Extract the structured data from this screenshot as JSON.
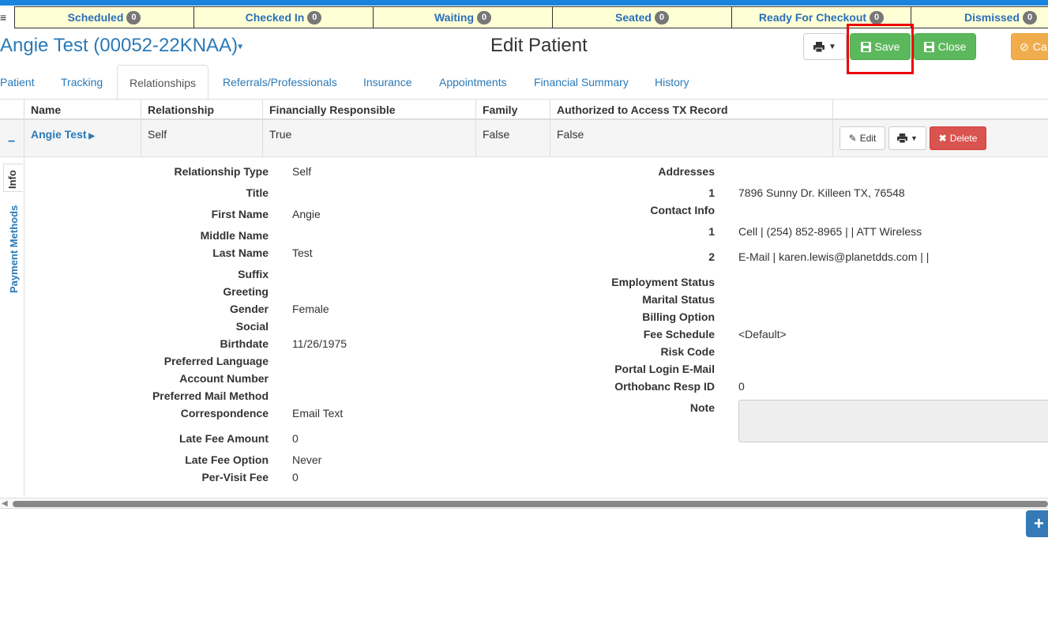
{
  "status_bar": [
    {
      "label": "Scheduled",
      "count": "0"
    },
    {
      "label": "Checked In",
      "count": "0"
    },
    {
      "label": "Waiting",
      "count": "0"
    },
    {
      "label": "Seated",
      "count": "0"
    },
    {
      "label": "Ready For Checkout",
      "count": "0"
    },
    {
      "label": "Dismissed",
      "count": "0"
    }
  ],
  "header": {
    "patient_name": "Angie Test (00052-22KNAA)",
    "page_title": "Edit Patient",
    "save_label": "Save",
    "close_label": "Close",
    "cancel_label": "Ca"
  },
  "tabs": [
    "Patient",
    "Tracking",
    "Relationships",
    "Referrals/Professionals",
    "Insurance",
    "Appointments",
    "Financial Summary",
    "History"
  ],
  "table": {
    "headers": [
      "Name",
      "Relationship",
      "Financially Responsible",
      "Family",
      "Authorized to Access TX Record"
    ],
    "row": {
      "name": "Angie Test",
      "relationship": "Self",
      "financially_responsible": "True",
      "family": "False",
      "authorized": "False",
      "edit_label": "Edit",
      "delete_label": "Delete"
    }
  },
  "side_tabs": {
    "info": "Info",
    "payment_methods": "Payment Methods"
  },
  "details_left": [
    {
      "label": "Relationship Type",
      "value": "Self"
    },
    {
      "label": "Title",
      "value": ""
    },
    {
      "label": "First Name",
      "value": "Angie"
    },
    {
      "label": "Middle Name",
      "value": ""
    },
    {
      "label": "Last Name",
      "value": "Test"
    },
    {
      "label": "Suffix",
      "value": ""
    },
    {
      "label": "Greeting",
      "value": ""
    },
    {
      "label": "Gender",
      "value": "Female"
    },
    {
      "label": "Social",
      "value": ""
    },
    {
      "label": "Birthdate",
      "value": "11/26/1975"
    },
    {
      "label": "Preferred Language",
      "value": ""
    },
    {
      "label": "Account Number",
      "value": ""
    },
    {
      "label": "Preferred Mail Method",
      "value": ""
    },
    {
      "label": "Correspondence",
      "value": "Email Text"
    },
    {
      "label": "Late Fee Amount",
      "value": "0"
    },
    {
      "label": "Late Fee Option",
      "value": "Never"
    },
    {
      "label": "Per-Visit Fee",
      "value": "0"
    }
  ],
  "details_right": {
    "addresses_label": "Addresses",
    "address_num": "1",
    "address_value": "7896 Sunny Dr. Killeen TX, 76548",
    "contact_label": "Contact Info",
    "contact1_num": "1",
    "contact1_value": "Cell | (254) 852-8965 | | ATT Wireless",
    "contact2_num": "2",
    "contact2_value": "E-Mail | karen.lewis@planetdds.com | |",
    "employment_label": "Employment Status",
    "marital_label": "Marital Status",
    "billing_label": "Billing Option",
    "fee_label": "Fee Schedule",
    "fee_value": "<Default>",
    "risk_label": "Risk Code",
    "portal_label": "Portal Login E-Mail",
    "orthobanc_label": "Orthobanc Resp ID",
    "orthobanc_value": "0",
    "note_label": "Note"
  },
  "fab_symbol": "+"
}
